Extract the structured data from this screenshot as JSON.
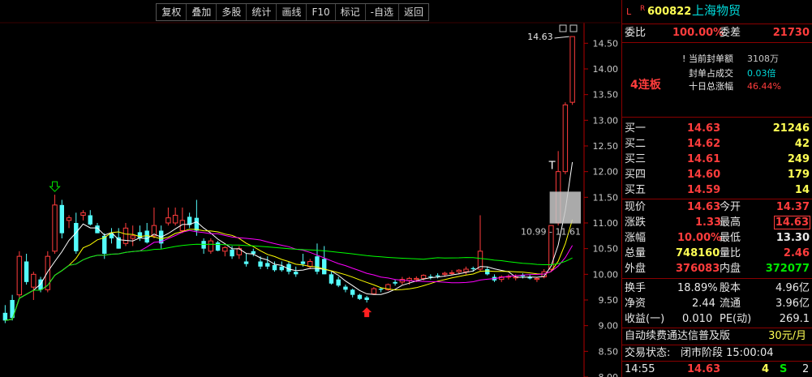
{
  "toolbar": {
    "buttons": [
      "复权",
      "叠加",
      "多股",
      "统计",
      "画线",
      "F10",
      "标记",
      "-自选",
      "返回"
    ]
  },
  "header": {
    "market_letter": "L",
    "flag_letter": "R",
    "code": "600822",
    "name": "上海物贸"
  },
  "weibi": {
    "label": "委比",
    "value": "100.00%",
    "diff_label": "委差",
    "diff_value": "21730"
  },
  "seal": {
    "limit_up_tag": "4连板",
    "items": [
      {
        "label": "当前封单额",
        "value": "3108万"
      },
      {
        "label": "封单占成交",
        "value": "0.03倍"
      },
      {
        "label": "十日总涨幅",
        "value": "46.44%"
      }
    ]
  },
  "bids": [
    {
      "label": "买一",
      "price": "14.63",
      "vol": "21246"
    },
    {
      "label": "买二",
      "price": "14.62",
      "vol": "42"
    },
    {
      "label": "买三",
      "price": "14.61",
      "vol": "249"
    },
    {
      "label": "买四",
      "price": "14.60",
      "vol": "179"
    },
    {
      "label": "买五",
      "price": "14.59",
      "vol": "14"
    }
  ],
  "quote": {
    "now_label": "现价",
    "now": "14.63",
    "open_label": "今开",
    "open": "14.37",
    "chg_label": "涨跌",
    "chg": "1.33",
    "high_label": "最高",
    "high": "14.63",
    "pct_label": "涨幅",
    "pct": "10.00%",
    "low_label": "最低",
    "low": "13.30",
    "vol_label": "总量",
    "vol": "748160",
    "vr_label": "量比",
    "vr": "2.46",
    "outer_label": "外盘",
    "outer": "376083",
    "inner_label": "内盘",
    "inner": "372077"
  },
  "finance": {
    "turnover_label": "换手",
    "turnover": "18.89%",
    "equity_label": "股本",
    "equity": "4.96亿",
    "nav_label": "净资",
    "nav": "2.44",
    "float_label": "流通",
    "float": "3.96亿",
    "eps_label": "收益(一)",
    "eps": "0.010",
    "pe_label": "PE(动)",
    "pe": "269.1"
  },
  "promo": {
    "text": "自动续费通达信普及版",
    "price": "30元/月"
  },
  "status": {
    "label": "交易状态:",
    "value": "闭市阶段 15:00:04"
  },
  "tick": {
    "time": "14:55",
    "price": "14.63",
    "vol": "4",
    "side": "S",
    "num": "2"
  },
  "chart_data": {
    "type": "candlestick",
    "ylim": [
      8.0,
      14.9
    ],
    "y_ticks": [
      "14.50",
      "14.00",
      "13.50",
      "13.00",
      "12.50",
      "12.00",
      "11.50",
      "11.00",
      "10.50",
      "10.00",
      "9.50",
      "9.00",
      "8.50",
      "8.00"
    ],
    "annotations": {
      "max_price_label": "14.63",
      "range_label": "10.99 - 11.61",
      "t_marker": "T"
    },
    "candles": [
      [
        9.25,
        9.4,
        9.05,
        9.1
      ],
      [
        9.5,
        9.6,
        9.1,
        9.15
      ],
      [
        9.6,
        10.45,
        9.55,
        10.35
      ],
      [
        10.25,
        10.4,
        9.8,
        9.85
      ],
      [
        9.75,
        10.05,
        9.5,
        10.0
      ],
      [
        9.9,
        9.95,
        9.65,
        9.7
      ],
      [
        9.7,
        10.45,
        9.65,
        10.35
      ],
      [
        10.45,
        11.55,
        10.4,
        11.35
      ],
      [
        11.35,
        11.45,
        10.7,
        10.8
      ],
      [
        11.05,
        11.15,
        10.9,
        11.1
      ],
      [
        11.0,
        11.2,
        10.4,
        10.45
      ],
      [
        11.15,
        11.25,
        11.05,
        11.2
      ],
      [
        11.15,
        11.25,
        10.95,
        10.97
      ],
      [
        10.95,
        11.0,
        10.8,
        10.8
      ],
      [
        10.75,
        10.8,
        10.3,
        10.4
      ],
      [
        10.8,
        10.9,
        10.6,
        10.7
      ],
      [
        10.72,
        10.9,
        10.5,
        10.5
      ],
      [
        10.6,
        11.0,
        10.55,
        10.9
      ],
      [
        10.7,
        10.95,
        10.55,
        10.75
      ],
      [
        10.82,
        10.95,
        10.65,
        10.7
      ],
      [
        10.85,
        11.0,
        10.6,
        10.62
      ],
      [
        10.75,
        11.3,
        10.7,
        10.95
      ],
      [
        10.85,
        10.95,
        10.5,
        10.6
      ],
      [
        11.0,
        11.3,
        10.95,
        11.1
      ],
      [
        11.0,
        11.3,
        10.95,
        11.15
      ],
      [
        10.85,
        11.3,
        10.8,
        11.05
      ],
      [
        11.12,
        11.2,
        10.9,
        10.96
      ],
      [
        11.1,
        11.45,
        10.75,
        10.85
      ],
      [
        10.65,
        10.7,
        10.4,
        10.5
      ],
      [
        10.45,
        10.7,
        10.4,
        10.65
      ],
      [
        10.62,
        10.65,
        10.45,
        10.46
      ],
      [
        10.45,
        10.55,
        10.35,
        10.52
      ],
      [
        10.48,
        10.55,
        10.3,
        10.35
      ],
      [
        10.38,
        10.55,
        10.3,
        10.5
      ],
      [
        10.25,
        10.4,
        10.15,
        10.2
      ],
      [
        10.45,
        10.5,
        10.35,
        10.4
      ],
      [
        10.25,
        10.35,
        10.1,
        10.15
      ],
      [
        10.22,
        10.35,
        10.1,
        10.15
      ],
      [
        10.18,
        10.25,
        10.05,
        10.08
      ],
      [
        10.15,
        10.25,
        10.05,
        10.08
      ],
      [
        10.2,
        10.25,
        10.0,
        10.05
      ],
      [
        10.05,
        10.15,
        9.95,
        10.0
      ],
      [
        10.25,
        10.4,
        10.15,
        10.2
      ],
      [
        10.15,
        10.3,
        10.1,
        10.25
      ],
      [
        10.35,
        10.6,
        10.0,
        10.05
      ],
      [
        10.3,
        10.55,
        10.0,
        10.0
      ],
      [
        10.0,
        10.05,
        9.8,
        9.82
      ],
      [
        9.9,
        9.95,
        9.75,
        9.78
      ],
      [
        9.76,
        9.8,
        9.65,
        9.7
      ],
      [
        9.7,
        9.72,
        9.55,
        9.6
      ],
      [
        9.6,
        9.62,
        9.5,
        9.52
      ],
      [
        9.55,
        9.58,
        9.45,
        9.5
      ],
      [
        9.62,
        9.75,
        9.6,
        9.72
      ],
      [
        9.72,
        9.75,
        9.65,
        9.7
      ],
      [
        9.7,
        9.82,
        9.68,
        9.8
      ],
      [
        9.85,
        9.9,
        9.78,
        9.82
      ],
      [
        9.85,
        9.95,
        9.8,
        9.9
      ],
      [
        9.88,
        9.95,
        9.8,
        9.92
      ],
      [
        9.9,
        9.96,
        9.85,
        9.92
      ],
      [
        9.92,
        10.0,
        9.88,
        9.98
      ],
      [
        9.96,
        10.0,
        9.9,
        9.95
      ],
      [
        9.98,
        10.02,
        9.92,
        9.96
      ],
      [
        10.0,
        10.05,
        9.95,
        10.02
      ],
      [
        10.02,
        10.08,
        9.98,
        10.03
      ],
      [
        10.05,
        10.1,
        10.0,
        10.08
      ],
      [
        10.05,
        10.15,
        10.0,
        10.1
      ],
      [
        10.12,
        10.15,
        10.05,
        10.1
      ],
      [
        10.1,
        11.15,
        10.05,
        10.45
      ],
      [
        10.1,
        10.15,
        9.98,
        10.0
      ],
      [
        9.95,
        10.0,
        9.85,
        9.88
      ],
      [
        9.9,
        9.98,
        9.85,
        9.95
      ],
      [
        9.95,
        10.0,
        9.9,
        9.96
      ],
      [
        9.93,
        10.0,
        9.88,
        9.95
      ],
      [
        9.98,
        10.02,
        9.92,
        9.96
      ],
      [
        9.95,
        10.0,
        9.9,
        9.92
      ],
      [
        9.9,
        9.95,
        9.85,
        9.92
      ],
      [
        9.95,
        10.1,
        9.92,
        10.05
      ],
      [
        10.1,
        10.95,
        10.05,
        10.95
      ],
      [
        11.0,
        12.4,
        10.95,
        12.0
      ],
      [
        12.0,
        13.35,
        11.95,
        13.3
      ],
      [
        13.35,
        14.63,
        13.3,
        14.63
      ]
    ],
    "ma": [
      {
        "name": "MA5",
        "color": "#ffffff",
        "values": []
      },
      {
        "name": "MA10",
        "color": "#ffff00",
        "values": []
      },
      {
        "name": "MA20",
        "color": "#ff00ff",
        "values": []
      },
      {
        "name": "MA60",
        "color": "#00ff00",
        "values": []
      }
    ],
    "colors": {
      "up": "#ff3c3c",
      "down": "#54fcfc",
      "axis": "#b00000"
    }
  }
}
